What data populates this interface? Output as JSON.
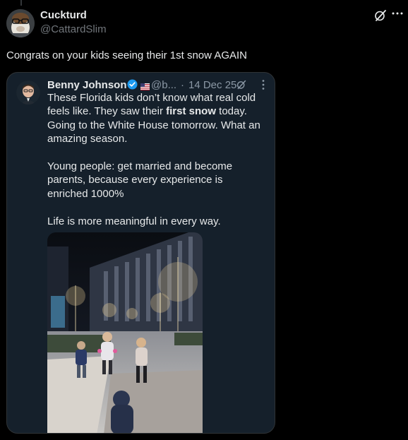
{
  "post": {
    "author_name": "Cuckturd",
    "author_handle": "@CattardSlim",
    "text": "Congrats on your kids seeing their 1st snow AGAIN"
  },
  "quote": {
    "author_name": "Benny Johnson",
    "handle": "@b...",
    "separator": "·",
    "date": "14 Dec 25",
    "paragraph1": {
      "line1": "These Florida kids don’t know what real cold",
      "line2_pre": "feels like. They saw their ",
      "line2_bold": "first snow",
      "line2_post": " today.",
      "line3": "Going to the White House tomorrow. What an",
      "line4": "amazing season."
    },
    "paragraph2": {
      "line1": "Young people: get married and become",
      "line2": "parents, because every experience is",
      "line3": "enriched 1000%"
    },
    "paragraph3": {
      "line1": "Life is more meaningful in every way."
    },
    "media": "children playing in snow video"
  },
  "colors": {
    "background": "#000000",
    "card_background": "#15202b",
    "text_primary": "#e7e9ea",
    "text_secondary": "#71767b",
    "verified_blue": "#1d9bf0"
  },
  "icons": [
    "grok-icon",
    "more-icon",
    "verified-badge-icon",
    "flag-icon"
  ]
}
